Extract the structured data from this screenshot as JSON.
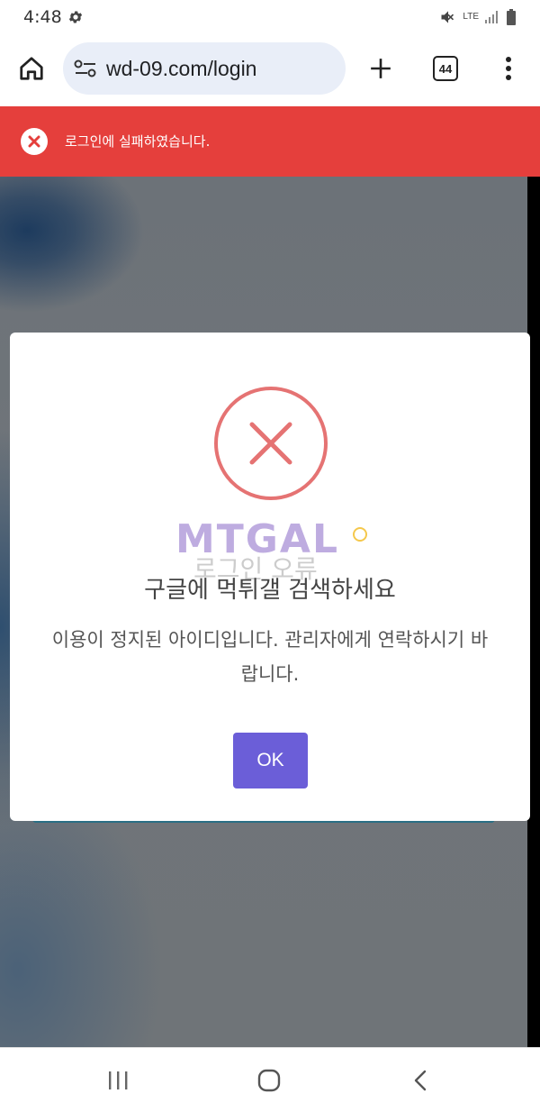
{
  "status_bar": {
    "time": "4:48",
    "network": "LTE",
    "icons": [
      "gear-icon",
      "mute-icon",
      "signal-icon",
      "battery-icon"
    ]
  },
  "browser": {
    "url": "wd-09.com/login",
    "tab_count": "44",
    "icons": [
      "home-icon",
      "site-settings-icon",
      "new-tab-icon",
      "tabs-icon",
      "menu-icon"
    ]
  },
  "error_banner": {
    "message": "로그인에 실패하였습니다.",
    "color": "#e53f3c"
  },
  "modal": {
    "watermark_text": "MTGAL",
    "watermark_subtext": "로그인 오류",
    "title": "구글에 먹튀갤 검색하세요",
    "message": "이용이 정지된 아이디입니다. 관리자에게 연락하시기 바랍니다.",
    "ok_label": "OK",
    "icon": "error-circle-icon",
    "icon_color": "#e57373",
    "button_color": "#6b5ed8"
  },
  "nav_bar": {
    "icons": [
      "recents-icon",
      "home-nav-icon",
      "back-icon"
    ]
  }
}
